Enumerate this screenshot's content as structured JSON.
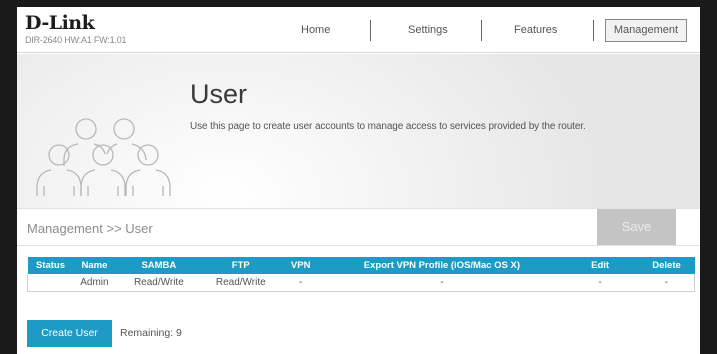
{
  "brand": {
    "name": "D-Link",
    "model": "DIR-2640 HW:A1 FW:1.01"
  },
  "nav": {
    "home": "Home",
    "settings": "Settings",
    "features": "Features",
    "management": "Management"
  },
  "hero": {
    "title": "User",
    "description": "Use this page to create user accounts to manage access to services provided by the router."
  },
  "breadcrumb": "Management >> User",
  "save_label": "Save",
  "table": {
    "headers": [
      "Status",
      "Name",
      "SAMBA",
      "FTP",
      "VPN",
      "Export VPN Profile (iOS/Mac OS X)",
      "Edit",
      "Delete"
    ],
    "rows": [
      [
        "",
        "Admin",
        "Read/Write",
        "Read/Write",
        "-",
        "-",
        "-",
        "-"
      ]
    ]
  },
  "create_label": "Create User",
  "remaining": "Remaining: 9",
  "colors": {
    "accent": "#1e9bc4",
    "save_disabled": "#c4c4c4"
  }
}
